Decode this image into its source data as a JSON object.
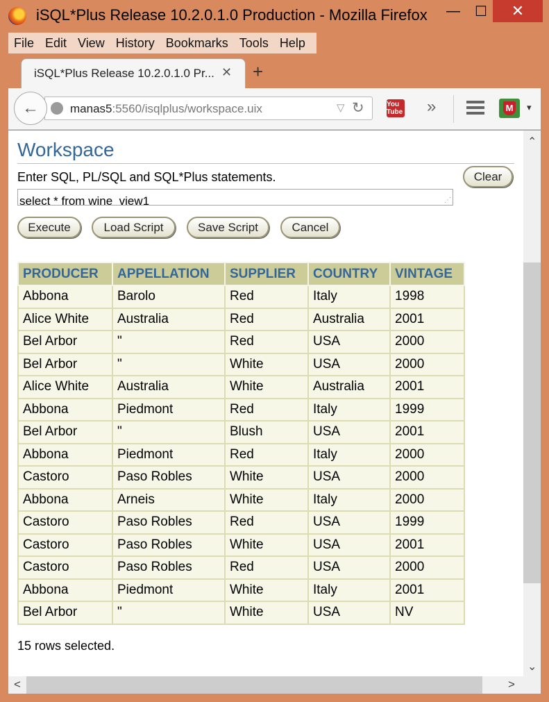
{
  "window": {
    "title": "iSQL*Plus Release 10.2.0.1.0 Production - Mozilla Firefox",
    "min_glyph": "—",
    "max_glyph": "☐",
    "close_glyph": "✕"
  },
  "menu": [
    "File",
    "Edit",
    "View",
    "History",
    "Bookmarks",
    "Tools",
    "Help"
  ],
  "tab": {
    "title": "iSQL*Plus Release 10.2.0.1.0 Pr...",
    "close_glyph": "✕",
    "new_tab_glyph": "+"
  },
  "nav": {
    "back_glyph": "←",
    "url_host": "manas5",
    "url_rest": ":5560/isqlplus/workspace.uix",
    "dropdown_glyph": "▽",
    "reload_glyph": "↻",
    "overflow_glyph": "»",
    "youtube_label": "You Tube",
    "menu_dd_glyph": "▾"
  },
  "workspace": {
    "title": "Workspace",
    "instructions": "Enter SQL, PL/SQL and SQL*Plus statements.",
    "sql_text": "select * from wine_view1",
    "buttons": {
      "clear": "Clear",
      "execute": "Execute",
      "load_script": "Load Script",
      "save_script": "Save Script",
      "cancel": "Cancel"
    }
  },
  "results": {
    "columns": [
      "PRODUCER",
      "APPELLATION",
      "SUPPLIER",
      "COUNTRY",
      "VINTAGE"
    ],
    "rows": [
      [
        "Abbona",
        "Barolo",
        "Red",
        "Italy",
        "1998"
      ],
      [
        "Alice White",
        "Australia",
        "Red",
        "Australia",
        "2001"
      ],
      [
        "Bel Arbor",
        "\"",
        "Red",
        "USA",
        "2000"
      ],
      [
        "Bel Arbor",
        "\"",
        "White",
        "USA",
        "2000"
      ],
      [
        "Alice White",
        "Australia",
        "White",
        "Australia",
        "2001"
      ],
      [
        "Abbona",
        "Piedmont",
        "Red",
        "Italy",
        "1999"
      ],
      [
        "Bel Arbor",
        "\"",
        "Blush",
        "USA",
        "2001"
      ],
      [
        "Abbona",
        "Piedmont",
        "Red",
        "Italy",
        "2000"
      ],
      [
        "Castoro",
        "Paso Robles",
        "White",
        "USA",
        "2000"
      ],
      [
        "Abbona",
        "Arneis",
        "White",
        "Italy",
        "2000"
      ],
      [
        "Castoro",
        "Paso Robles",
        "Red",
        "USA",
        "1999"
      ],
      [
        "Castoro",
        "Paso Robles",
        "White",
        "USA",
        "2001"
      ],
      [
        "Castoro",
        "Paso Robles",
        "Red",
        "USA",
        "2000"
      ],
      [
        "Abbona",
        "Piedmont",
        "White",
        "Italy",
        "2001"
      ],
      [
        "Bel Arbor",
        "\"",
        "White",
        "USA",
        "NV"
      ]
    ],
    "summary": "15 rows selected."
  },
  "scroll": {
    "up_glyph": "⌃",
    "down_glyph": "⌄",
    "left_glyph": "<",
    "right_glyph": ">"
  },
  "colors": {
    "window_frame": "#d9895e",
    "heading_blue": "#336699",
    "header_bg": "#cccc99",
    "cell_bg": "#f7f7e7"
  }
}
